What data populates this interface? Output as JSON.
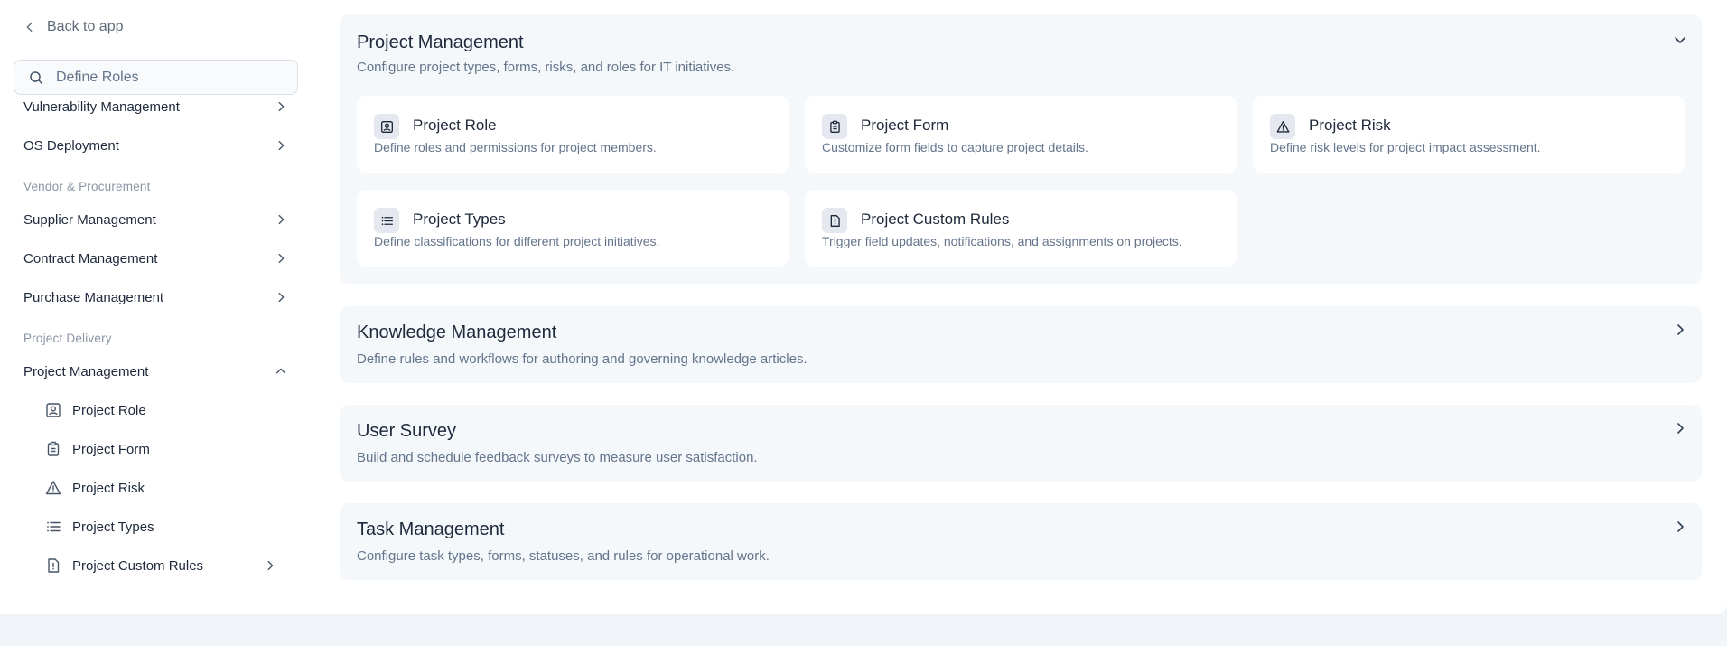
{
  "sidebar": {
    "back_label": "Back to app",
    "search_placeholder": "Define Roles",
    "items": [
      {
        "label": "Vulnerability Management"
      },
      {
        "label": "OS Deployment"
      }
    ],
    "section_vendor": "Vendor & Procurement",
    "vendor_items": [
      {
        "label": "Supplier Management"
      },
      {
        "label": "Contract Management"
      },
      {
        "label": "Purchase Management"
      }
    ],
    "section_delivery": "Project Delivery",
    "project_management": {
      "label": "Project Management"
    },
    "sub_items": [
      {
        "label": "Project Role",
        "icon": "user-badge-icon"
      },
      {
        "label": "Project Form",
        "icon": "clipboard-icon"
      },
      {
        "label": "Project Risk",
        "icon": "warning-icon"
      },
      {
        "label": "Project Types",
        "icon": "list-icon"
      },
      {
        "label": "Project Custom Rules",
        "icon": "file-alert-icon"
      }
    ]
  },
  "main": {
    "project_management": {
      "title": "Project Management",
      "description": "Configure project types, forms, risks, and roles for IT initiatives.",
      "cards": [
        {
          "title": "Project Role",
          "description": "Define roles and permissions for project members.",
          "icon": "user-badge-icon"
        },
        {
          "title": "Project Form",
          "description": "Customize form fields to capture project details.",
          "icon": "clipboard-icon"
        },
        {
          "title": "Project Risk",
          "description": "Define risk levels for project impact assessment.",
          "icon": "warning-icon"
        },
        {
          "title": "Project Types",
          "description": "Define classifications for different project initiatives.",
          "icon": "list-icon"
        },
        {
          "title": "Project Custom Rules",
          "description": "Trigger field updates, notifications, and assignments on projects.",
          "icon": "file-alert-icon"
        }
      ]
    },
    "knowledge_management": {
      "title": "Knowledge Management",
      "description": "Define rules and workflows for authoring and governing knowledge articles."
    },
    "user_survey": {
      "title": "User Survey",
      "description": "Build and schedule feedback surveys to measure user satisfaction."
    },
    "task_management": {
      "title": "Task Management",
      "description": "Configure task types, forms, statuses, and rules for operational work."
    }
  }
}
